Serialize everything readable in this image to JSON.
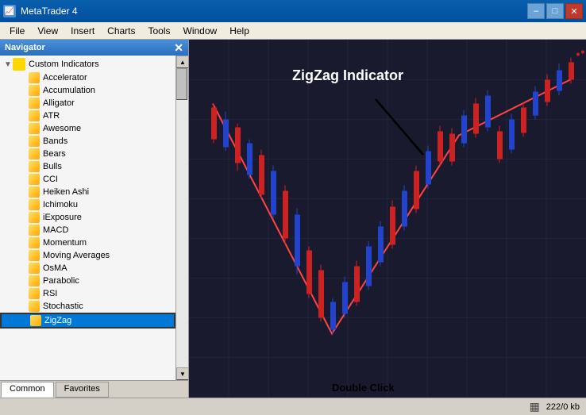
{
  "titleBar": {
    "title": "MetaTrader 4",
    "minimizeLabel": "–",
    "maximizeLabel": "□",
    "closeLabel": "✕"
  },
  "menuBar": {
    "items": [
      "File",
      "View",
      "Insert",
      "Charts",
      "Tools",
      "Window",
      "Help"
    ]
  },
  "navigator": {
    "title": "Navigator",
    "closeLabel": "✕",
    "tree": {
      "rootLabel": "Custom Indicators",
      "items": [
        "Accelerator",
        "Accumulation",
        "Alligator",
        "ATR",
        "Awesome",
        "Bands",
        "Bears",
        "Bulls",
        "CCI",
        "Heiken Ashi",
        "Ichimoku",
        "iExposure",
        "MACD",
        "Momentum",
        "Moving Averages",
        "OsMA",
        "Parabolic",
        "RSI",
        "Stochastic",
        "ZigZag"
      ]
    },
    "tabs": [
      {
        "label": "Common",
        "active": true
      },
      {
        "label": "Favorites",
        "active": false
      }
    ]
  },
  "chart": {
    "annotation": "ZigZag Indicator",
    "doubleClickLabel": "Double Click"
  },
  "statusBar": {
    "memoryLabel": "222/0 kb",
    "iconsSymbol": "▦"
  }
}
